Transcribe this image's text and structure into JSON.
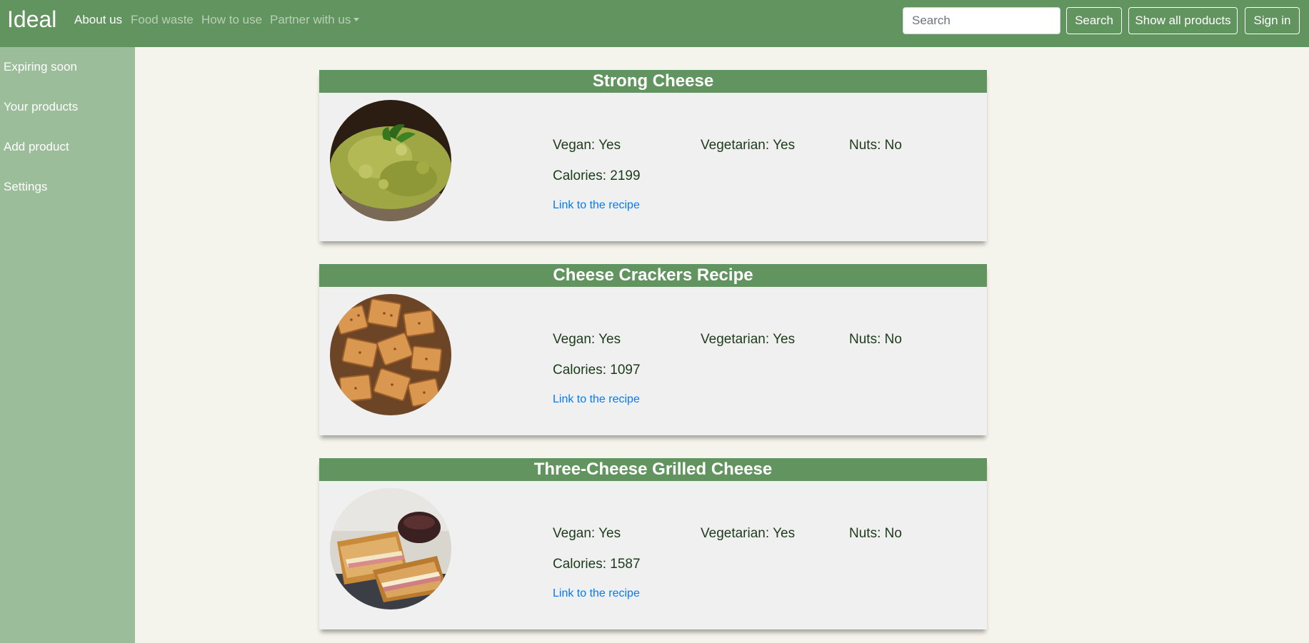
{
  "navbar": {
    "brand": "Ideal",
    "links": [
      "About us",
      "Food waste",
      "How to use",
      "Partner with us"
    ],
    "search_placeholder": "Search",
    "search_button": "Search",
    "show_all_button": "Show all products",
    "sign_in_button": "Sign in",
    "active_link": "About us"
  },
  "sidebar": {
    "items": [
      "Expiring soon",
      "Your products",
      "Add product",
      "Settings"
    ]
  },
  "colors": {
    "navbar": "#62945f",
    "sidebar": "#9cbd99",
    "page_background": "#f5f4ec",
    "card_background": "#f0f0f0",
    "link": "#007bff"
  },
  "recipes": [
    {
      "title": "Strong Cheese",
      "image": "dip-photo",
      "vegan": "Vegan: Yes",
      "vegetarian": "Vegetarian: Yes",
      "nuts": "Nuts: No",
      "calories": "Calories: 2199",
      "link": "Link to the recipe"
    },
    {
      "title": "Cheese Crackers Recipe",
      "image": "crackers-photo",
      "vegan": "Vegan: Yes",
      "vegetarian": "Vegetarian: Yes",
      "nuts": "Nuts: No",
      "calories": "Calories: 1097",
      "link": "Link to the recipe"
    },
    {
      "title": "Three-Cheese Grilled Cheese",
      "image": "grilled-cheese-photo",
      "vegan": "Vegan: Yes",
      "vegetarian": "Vegetarian: Yes",
      "nuts": "Nuts: No",
      "calories": "Calories: 1587",
      "link": "Link to the recipe"
    }
  ]
}
